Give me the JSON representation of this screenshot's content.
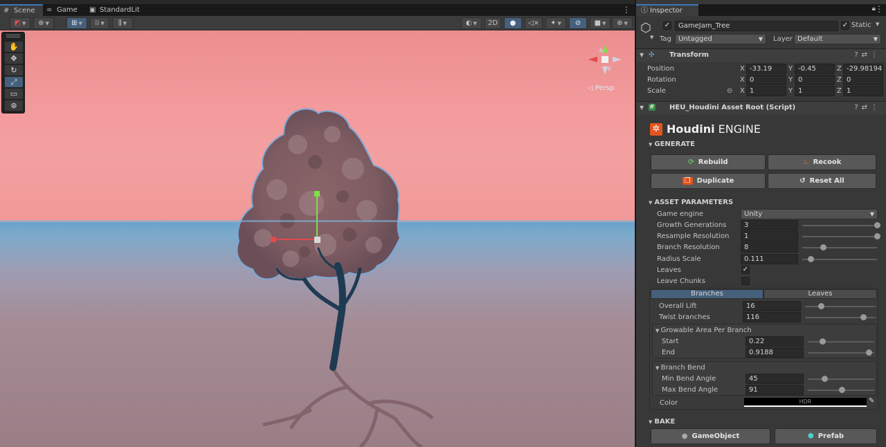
{
  "scene": {
    "tabs": [
      {
        "label": "Scene",
        "icon": "grid-icon"
      },
      {
        "label": "Game",
        "icon": "gamepad-icon"
      },
      {
        "label": "StandardLit",
        "icon": "shader-icon"
      }
    ],
    "toolbar": {
      "mode_2d": "2D"
    },
    "persp_label": "◁ Persp"
  },
  "inspector": {
    "tab_label": "Inspector",
    "object": {
      "active": true,
      "name": "GameJam_Tree",
      "static_label": "Static",
      "static_checked": true,
      "tag_label": "Tag",
      "tag_value": "Untagged",
      "layer_label": "Layer",
      "layer_value": "Default"
    },
    "transform": {
      "title": "Transform",
      "position_label": "Position",
      "rotation_label": "Rotation",
      "scale_label": "Scale",
      "position": {
        "x": "-33.19",
        "y": "-0.45",
        "z": "-29.98194"
      },
      "rotation": {
        "x": "0",
        "y": "0",
        "z": "0"
      },
      "scale": {
        "x": "1",
        "y": "1",
        "z": "1"
      },
      "axis_x": "X",
      "axis_y": "Y",
      "axis_z": "Z"
    },
    "script": {
      "title": "HEU_Houdini Asset Root (Script)",
      "logo_bold": "Houdini",
      "logo_rest": " ENGINE",
      "generate_section": "GENERATE",
      "rebuild": "Rebuild",
      "recook": "Recook",
      "duplicate": "Duplicate",
      "reset_all": "Reset All",
      "asset_params_section": "ASSET PARAMETERS",
      "game_engine_label": "Game engine",
      "game_engine_value": "Unity",
      "params": [
        {
          "label": "Growth Generations",
          "value": "3",
          "slider": 1.0
        },
        {
          "label": "Resample Resolution",
          "value": "1",
          "slider": 1.0
        },
        {
          "label": "Branch Resolution",
          "value": "8",
          "slider": 0.28
        },
        {
          "label": "Radius Scale",
          "value": "0.111",
          "slider": 0.11
        }
      ],
      "leaves_label": "Leaves",
      "leaves_checked": true,
      "leave_chunks_label": "Leave Chunks",
      "leave_chunks_checked": false,
      "tab_branches": "Branches",
      "tab_leaves": "Leaves",
      "branch_params": [
        {
          "label": "Overall Lift",
          "value": "16",
          "slider": 0.23
        },
        {
          "label": "Twist branches",
          "value": "116",
          "slider": 0.82
        }
      ],
      "growable_title": "Growable Area Per Branch",
      "growable": [
        {
          "label": "Start",
          "value": "0.22",
          "slider": 0.22
        },
        {
          "label": "End",
          "value": "0.9188",
          "slider": 0.92
        }
      ],
      "bend_title": "Branch Bend",
      "bend": [
        {
          "label": "Min Bend Angle",
          "value": "45",
          "slider": 0.25
        },
        {
          "label": "Max Bend Angle",
          "value": "91",
          "slider": 0.51
        }
      ],
      "color_label": "Color",
      "color_hdr": "HDR",
      "color_value": "#000000",
      "bake_section": "BAKE",
      "bake_gameobject": "GameObject",
      "bake_prefab": "Prefab"
    }
  }
}
